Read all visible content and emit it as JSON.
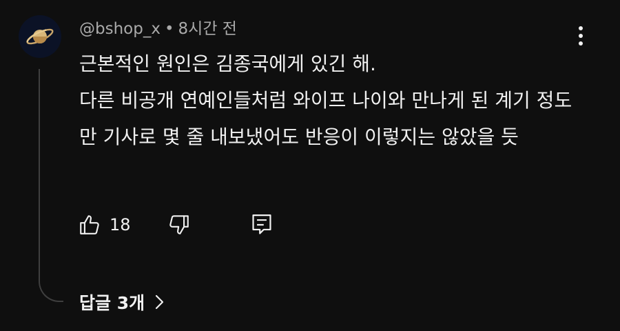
{
  "comment": {
    "author": "@bshop_x",
    "separator": "•",
    "time_ago": "8시간 전",
    "avatar_icon": "saturn-icon",
    "lines": [
      "근본적인 원인은 김종국에게 있긴 해.",
      "다른 비공개 연예인들처럼 와이프 나이와 만나게 된 계기 정도만 기사로 몇 줄 내보냈어도 반응이 이렇지는 않았을 듯"
    ],
    "like_count": "18",
    "more_icon": "more-vert-icon"
  },
  "actions": {
    "like_icon": "thumb-up-icon",
    "dislike_icon": "thumb-down-icon",
    "reply_icon": "reply-comment-icon"
  },
  "replies": {
    "label": "답글 3개",
    "chevron_icon": "chevron-right-icon"
  },
  "colors": {
    "background": "#0f0f0f",
    "text": "#f1f1f1",
    "secondary_text": "#aaaaaa",
    "thread_line": "#3f3f3f"
  }
}
